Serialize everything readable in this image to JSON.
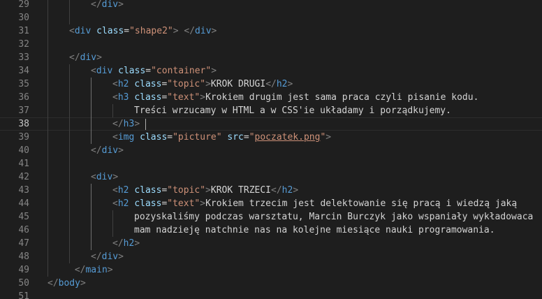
{
  "editor": {
    "language": "html",
    "theme": "dark",
    "colors": {
      "background": "#1e1e1e",
      "line_number": "#858585",
      "tag": "#569cd6",
      "attribute": "#9cdcfe",
      "string": "#ce9178",
      "text": "#d4d4d4",
      "bracket": "#808080"
    },
    "cursor": {
      "line": 38
    },
    "lines": [
      {
        "n": "29",
        "indent": 2,
        "tokens": [
          {
            "t": "punct",
            "v": "</"
          },
          {
            "t": "tag",
            "v": "div"
          },
          {
            "t": "punct",
            "v": ">"
          }
        ]
      },
      {
        "n": "30",
        "indent": 2,
        "tokens": []
      },
      {
        "n": "31",
        "indent": 1,
        "tokens": [
          {
            "t": "punct",
            "v": "<"
          },
          {
            "t": "tag",
            "v": "div"
          },
          {
            "t": "text",
            "v": " "
          },
          {
            "t": "attr",
            "v": "class"
          },
          {
            "t": "text",
            "v": "="
          },
          {
            "t": "str",
            "v": "\"shape2\""
          },
          {
            "t": "punct",
            "v": ">"
          },
          {
            "t": "text",
            "v": " "
          },
          {
            "t": "punct",
            "v": "</"
          },
          {
            "t": "tag",
            "v": "div"
          },
          {
            "t": "punct",
            "v": ">"
          }
        ]
      },
      {
        "n": "32",
        "indent": 1,
        "tokens": []
      },
      {
        "n": "33",
        "indent": 1,
        "tokens": [
          {
            "t": "punct",
            "v": "</"
          },
          {
            "t": "tag",
            "v": "div"
          },
          {
            "t": "punct",
            "v": ">"
          }
        ]
      },
      {
        "n": "34",
        "indent": 2,
        "tokens": [
          {
            "t": "punct",
            "v": "<"
          },
          {
            "t": "tag",
            "v": "div"
          },
          {
            "t": "text",
            "v": " "
          },
          {
            "t": "attr",
            "v": "class"
          },
          {
            "t": "text",
            "v": "="
          },
          {
            "t": "str",
            "v": "\"container\""
          },
          {
            "t": "punct",
            "v": ">"
          }
        ]
      },
      {
        "n": "35",
        "indent": 3,
        "tokens": [
          {
            "t": "punct",
            "v": "<"
          },
          {
            "t": "tag",
            "v": "h2"
          },
          {
            "t": "text",
            "v": " "
          },
          {
            "t": "attr",
            "v": "class"
          },
          {
            "t": "text",
            "v": "="
          },
          {
            "t": "str",
            "v": "\"topic\""
          },
          {
            "t": "punct",
            "v": ">"
          },
          {
            "t": "text",
            "v": "KROK DRUGI"
          },
          {
            "t": "punct",
            "v": "</"
          },
          {
            "t": "tag",
            "v": "h2"
          },
          {
            "t": "punct",
            "v": ">"
          }
        ]
      },
      {
        "n": "36",
        "indent": 3,
        "tokens": [
          {
            "t": "punct",
            "v": "<"
          },
          {
            "t": "tag",
            "v": "h3"
          },
          {
            "t": "text",
            "v": " "
          },
          {
            "t": "attr",
            "v": "class"
          },
          {
            "t": "text",
            "v": "="
          },
          {
            "t": "str",
            "v": "\"text\""
          },
          {
            "t": "punct",
            "v": ">"
          },
          {
            "t": "text",
            "v": "Krokiem drugim jest sama praca czyli pisanie kodu."
          }
        ]
      },
      {
        "n": "37",
        "indent": 4,
        "tokens": [
          {
            "t": "text",
            "v": "Treści wrzucamy w HTML a w CSS'ie układamy i porządkujemy."
          }
        ]
      },
      {
        "n": "38",
        "indent": 3,
        "tokens": [
          {
            "t": "punct",
            "v": "</"
          },
          {
            "t": "tag",
            "v": "h3"
          },
          {
            "t": "punct",
            "v": ">"
          },
          {
            "t": "text",
            "v": " "
          },
          {
            "t": "cursor",
            "v": ""
          }
        ]
      },
      {
        "n": "39",
        "indent": 3,
        "tokens": [
          {
            "t": "punct",
            "v": "<"
          },
          {
            "t": "tag",
            "v": "img"
          },
          {
            "t": "text",
            "v": " "
          },
          {
            "t": "attr",
            "v": "class"
          },
          {
            "t": "text",
            "v": "="
          },
          {
            "t": "str",
            "v": "\"picture\""
          },
          {
            "t": "text",
            "v": " "
          },
          {
            "t": "attr",
            "v": "src"
          },
          {
            "t": "text",
            "v": "="
          },
          {
            "t": "str",
            "v": "\""
          },
          {
            "t": "link",
            "v": "poczatek.png"
          },
          {
            "t": "str",
            "v": "\""
          },
          {
            "t": "punct",
            "v": ">"
          }
        ]
      },
      {
        "n": "40",
        "indent": 2,
        "tokens": [
          {
            "t": "punct",
            "v": "</"
          },
          {
            "t": "tag",
            "v": "div"
          },
          {
            "t": "punct",
            "v": ">"
          }
        ]
      },
      {
        "n": "41",
        "indent": 2,
        "tokens": []
      },
      {
        "n": "42",
        "indent": 2,
        "tokens": [
          {
            "t": "punct",
            "v": "<"
          },
          {
            "t": "tag",
            "v": "div"
          },
          {
            "t": "punct",
            "v": ">"
          }
        ]
      },
      {
        "n": "43",
        "indent": 3,
        "tokens": [
          {
            "t": "punct",
            "v": "<"
          },
          {
            "t": "tag",
            "v": "h2"
          },
          {
            "t": "text",
            "v": " "
          },
          {
            "t": "attr",
            "v": "class"
          },
          {
            "t": "text",
            "v": "="
          },
          {
            "t": "str",
            "v": "\"topic\""
          },
          {
            "t": "punct",
            "v": ">"
          },
          {
            "t": "text",
            "v": "KROK TRZECI"
          },
          {
            "t": "punct",
            "v": "</"
          },
          {
            "t": "tag",
            "v": "h2"
          },
          {
            "t": "punct",
            "v": ">"
          }
        ]
      },
      {
        "n": "44",
        "indent": 3,
        "tokens": [
          {
            "t": "punct",
            "v": "<"
          },
          {
            "t": "tag",
            "v": "h2"
          },
          {
            "t": "text",
            "v": " "
          },
          {
            "t": "attr",
            "v": "class"
          },
          {
            "t": "text",
            "v": "="
          },
          {
            "t": "str",
            "v": "\"text\""
          },
          {
            "t": "punct",
            "v": ">"
          },
          {
            "t": "text",
            "v": "Krokiem trzecim jest delektowanie się pracą i wiedzą jaką"
          }
        ]
      },
      {
        "n": "45",
        "indent": 4,
        "tokens": [
          {
            "t": "text",
            "v": "pozyskaliśmy podczas warsztatu, Marcin Burczyk jako wspaniały wykładowaca"
          }
        ]
      },
      {
        "n": "46",
        "indent": 4,
        "tokens": [
          {
            "t": "text",
            "v": "mam nadzieję natchnie nas na kolejne miesiące nauki programowania."
          }
        ]
      },
      {
        "n": "47",
        "indent": 3,
        "tokens": [
          {
            "t": "punct",
            "v": "</"
          },
          {
            "t": "tag",
            "v": "h2"
          },
          {
            "t": "punct",
            "v": ">"
          }
        ]
      },
      {
        "n": "48",
        "indent": 2,
        "tokens": [
          {
            "t": "punct",
            "v": "</"
          },
          {
            "t": "tag",
            "v": "div"
          },
          {
            "t": "punct",
            "v": ">"
          }
        ]
      },
      {
        "n": "49",
        "indent": 1,
        "tokens": [
          {
            "t": "text",
            "v": " "
          },
          {
            "t": "punct",
            "v": "</"
          },
          {
            "t": "tag",
            "v": "main"
          },
          {
            "t": "punct",
            "v": ">"
          }
        ]
      },
      {
        "n": "50",
        "indent": 0,
        "tokens": [
          {
            "t": "punct",
            "v": "</"
          },
          {
            "t": "tag",
            "v": "body"
          },
          {
            "t": "punct",
            "v": ">"
          }
        ]
      },
      {
        "n": "51",
        "indent": 0,
        "tokens": []
      }
    ]
  }
}
